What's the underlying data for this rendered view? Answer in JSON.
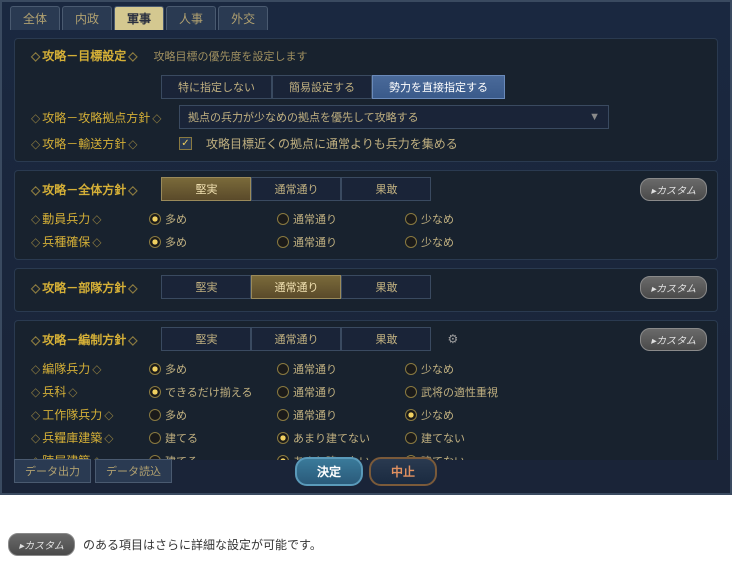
{
  "tabs": [
    "全体",
    "内政",
    "軍事",
    "人事",
    "外交"
  ],
  "active_tab": 2,
  "target": {
    "title": "攻略－目標設定",
    "desc": "攻略目標の優先度を設定します",
    "opts": [
      "特に指定しない",
      "簡易設定する",
      "勢力を直接指定する"
    ],
    "selected": 2
  },
  "base": {
    "title": "攻略－攻略拠点方針",
    "value": "拠点の兵力が少なめの拠点を優先して攻略する"
  },
  "transport": {
    "title": "攻略－輸送方針",
    "chk_label": "攻略目標近くの拠点に通常よりも兵力を集める",
    "checked": true
  },
  "overall": {
    "title": "攻略－全体方針",
    "segs": [
      "堅実",
      "通常通り",
      "果敢"
    ],
    "seg_sel": 0,
    "rows": [
      {
        "label": "動員兵力",
        "opts": [
          "多め",
          "通常通り",
          "少なめ"
        ],
        "sel": 0
      },
      {
        "label": "兵種確保",
        "opts": [
          "多め",
          "通常通り",
          "少なめ"
        ],
        "sel": 0
      }
    ]
  },
  "unit": {
    "title": "攻略－部隊方針",
    "segs": [
      "堅実",
      "通常通り",
      "果敢"
    ],
    "seg_sel": 1
  },
  "formation": {
    "title": "攻略－編制方針",
    "segs": [
      "堅実",
      "通常通り",
      "果敢"
    ],
    "seg_sel": -1,
    "rows": [
      {
        "label": "編隊兵力",
        "opts": [
          "多め",
          "通常通り",
          "少なめ"
        ],
        "sel": 0
      },
      {
        "label": "兵科",
        "opts": [
          "できるだけ揃える",
          "通常通り",
          "武将の適性重視"
        ],
        "sel": 0
      },
      {
        "label": "工作隊兵力",
        "opts": [
          "多め",
          "通常通り",
          "少なめ"
        ],
        "sel": 2
      },
      {
        "label": "兵糧庫建築",
        "opts": [
          "建てる",
          "あまり建てない",
          "建てない"
        ],
        "sel": 1
      },
      {
        "label": "陣屋建築",
        "opts": [
          "建てる",
          "あまり建てない",
          "建てない"
        ],
        "sel": 1
      }
    ]
  },
  "custom_label": "カスタム",
  "data_out": "データ出力",
  "data_in": "データ読込",
  "ok": "決定",
  "cancel": "中止",
  "footnote": "のある項目はさらに詳細な設定が可能です。"
}
